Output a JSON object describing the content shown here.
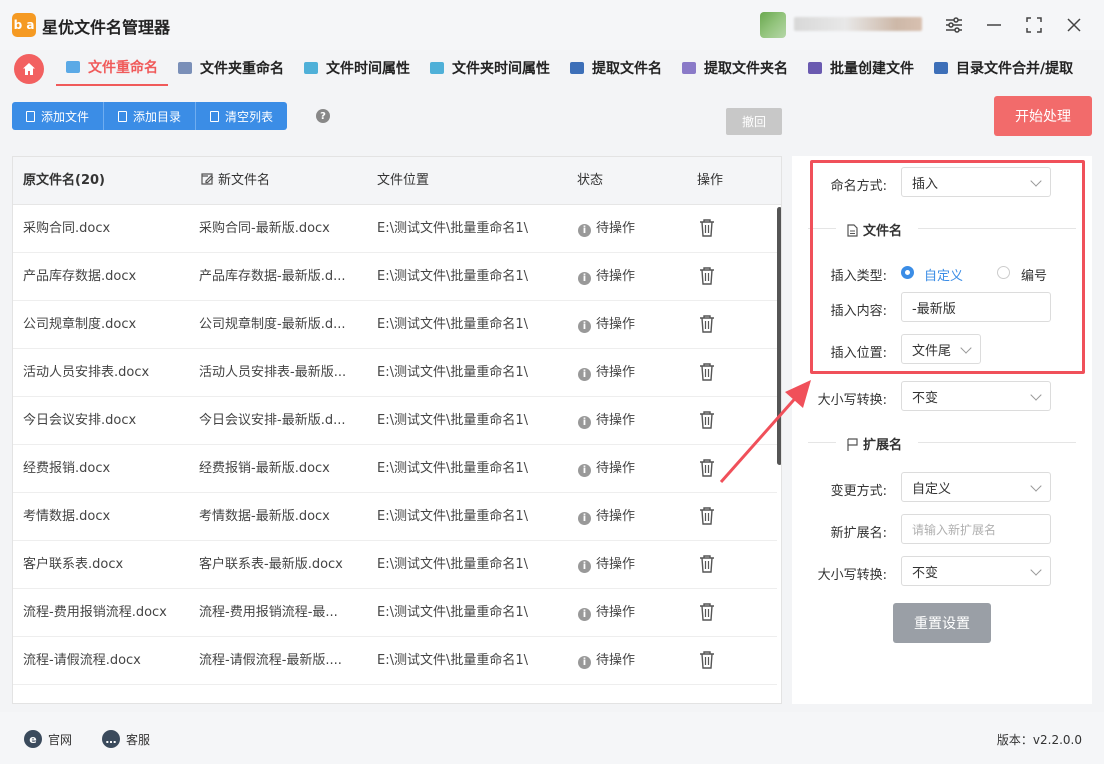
{
  "app": {
    "title": "星优文件名管理器",
    "logo_text": "b a"
  },
  "tabs": [
    {
      "label": "文件重命名",
      "color": "#5aa9e6"
    },
    {
      "label": "文件夹重命名",
      "color": "#7a8fb8"
    },
    {
      "label": "文件时间属性",
      "color": "#4fb0d8"
    },
    {
      "label": "文件夹时间属性",
      "color": "#4fb0d8"
    },
    {
      "label": "提取文件名",
      "color": "#3d6fb8"
    },
    {
      "label": "提取文件夹名",
      "color": "#8a7ac8"
    },
    {
      "label": "批量创建文件",
      "color": "#6a5ab0"
    },
    {
      "label": "目录文件合并/提取",
      "color": "#3d6fb8"
    }
  ],
  "toolbar": {
    "add_file": "添加文件",
    "add_dir": "添加目录",
    "clear_list": "清空列表",
    "help": "?",
    "undo": "撤回",
    "start": "开始处理"
  },
  "table": {
    "headers": {
      "original": "原文件名(20)",
      "new": "新文件名",
      "location": "文件位置",
      "status": "状态",
      "action": "操作"
    },
    "rows": [
      {
        "original": "采购合同.docx",
        "new": "采购合同-最新版.docx",
        "location": "E:\\测试文件\\批量重命名1\\",
        "status": "待操作"
      },
      {
        "original": "产品库存数据.docx",
        "new": "产品库存数据-最新版.d...",
        "location": "E:\\测试文件\\批量重命名1\\",
        "status": "待操作"
      },
      {
        "original": "公司规章制度.docx",
        "new": "公司规章制度-最新版.d...",
        "location": "E:\\测试文件\\批量重命名1\\",
        "status": "待操作"
      },
      {
        "original": "活动人员安排表.docx",
        "new": "活动人员安排表-最新版...",
        "location": "E:\\测试文件\\批量重命名1\\",
        "status": "待操作"
      },
      {
        "original": "今日会议安排.docx",
        "new": "今日会议安排-最新版.d...",
        "location": "E:\\测试文件\\批量重命名1\\",
        "status": "待操作"
      },
      {
        "original": "经费报销.docx",
        "new": "经费报销-最新版.docx",
        "location": "E:\\测试文件\\批量重命名1\\",
        "status": "待操作"
      },
      {
        "original": "考情数据.docx",
        "new": "考情数据-最新版.docx",
        "location": "E:\\测试文件\\批量重命名1\\",
        "status": "待操作"
      },
      {
        "original": "客户联系表.docx",
        "new": "客户联系表-最新版.docx",
        "location": "E:\\测试文件\\批量重命名1\\",
        "status": "待操作"
      },
      {
        "original": "流程-费用报销流程.docx",
        "new": "流程-费用报销流程-最...",
        "location": "E:\\测试文件\\批量重命名1\\",
        "status": "待操作"
      },
      {
        "original": "流程-请假流程.docx",
        "new": "流程-请假流程-最新版....",
        "location": "E:\\测试文件\\批量重命名1\\",
        "status": "待操作"
      }
    ]
  },
  "settings": {
    "naming_label": "命名方式:",
    "naming_value": "插入",
    "filename_section": "文件名",
    "insert_type_label": "插入类型:",
    "insert_type_custom": "自定义",
    "insert_type_number": "编号",
    "insert_content_label": "插入内容:",
    "insert_content_value": "-最新版",
    "insert_pos_label": "插入位置:",
    "insert_pos_value": "文件尾",
    "case_label": "大小写转换:",
    "case_value": "不变",
    "ext_section": "扩展名",
    "change_mode_label": "变更方式:",
    "change_mode_value": "自定义",
    "new_ext_label": "新扩展名:",
    "new_ext_placeholder": "请输入新扩展名",
    "ext_case_label": "大小写转换:",
    "ext_case_value": "不变",
    "reset": "重置设置"
  },
  "footer": {
    "website": "官网",
    "support": "客服",
    "version": "版本：v2.2.0.0"
  },
  "colors": {
    "accent": "#f05a5a",
    "primary": "#3b8de6",
    "highlight": "#f0505a"
  }
}
